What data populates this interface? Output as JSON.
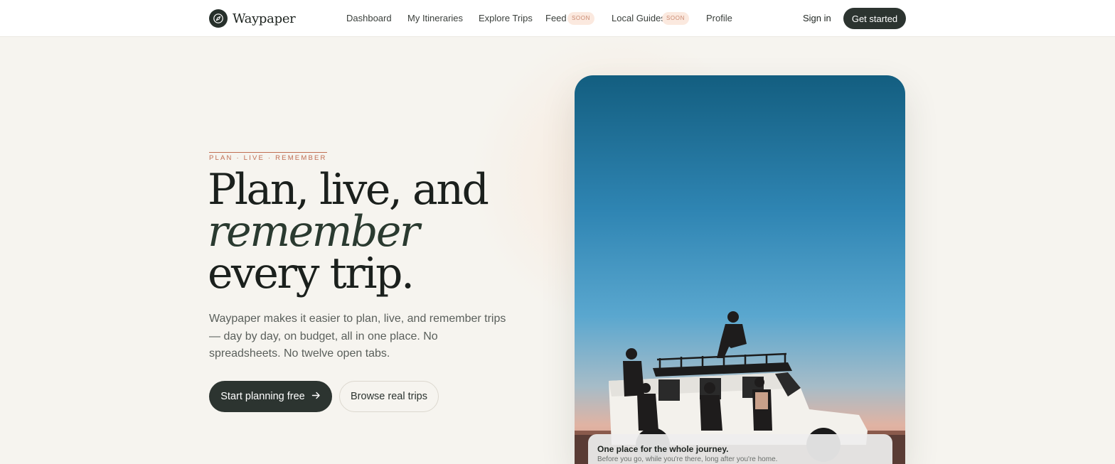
{
  "brand": {
    "name": "Waypaper",
    "logo_icon": "compass-icon"
  },
  "nav": {
    "items": [
      {
        "label": "Dashboard"
      },
      {
        "label": "My Itineraries"
      },
      {
        "label": "Explore Trips"
      },
      {
        "label": "Feed",
        "badge": "SOON"
      },
      {
        "label": "Local Guides",
        "badge": "SOON"
      },
      {
        "label": "Profile"
      }
    ],
    "sign_in": "Sign in",
    "get_started": "Get started"
  },
  "hero": {
    "eyebrow": "PLAN · LIVE · REMEMBER",
    "headline_1": "Plan, live, and",
    "headline_2": "remember",
    "headline_3": "every trip.",
    "lede": "Waypaper makes it easier to plan, live, and remember trips — day by day, on budget, all in one place. No spreadsheets. No twelve open tabs.",
    "primary_cta": "Start planning free",
    "primary_cta_icon": "arrow-right-icon",
    "secondary_cta": "Browse real trips"
  },
  "photo_card": {
    "caption_title": "One place for the whole journey.",
    "caption_sub": "Before you go, while you're there, long after you're home."
  },
  "colors": {
    "accent_dark": "#2c3430",
    "eyebrow": "#c06d52",
    "background": "#f6f4ef",
    "badge_bg": "#fbe9df"
  }
}
